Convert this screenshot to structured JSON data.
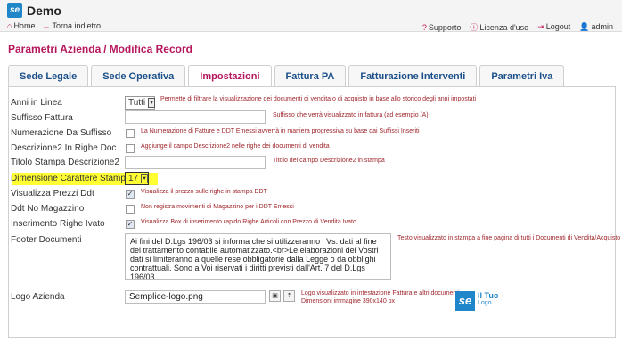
{
  "app": {
    "title": "Demo",
    "logo": "se"
  },
  "breadcrumb": {
    "home": "Home",
    "back": "Torna indietro"
  },
  "topnav": {
    "support": "Supporto",
    "license": "Licenza d'uso",
    "logout": "Logout",
    "user": "admin"
  },
  "page": {
    "title_part1": "Parametri Azienda",
    "title_sep": "/",
    "title_part2": "Modifica Record"
  },
  "tabs": [
    {
      "label": "Sede Legale"
    },
    {
      "label": "Sede Operativa"
    },
    {
      "label": "Impostazioni"
    },
    {
      "label": "Fattura PA"
    },
    {
      "label": "Fatturazione Interventi"
    },
    {
      "label": "Parametri Iva"
    }
  ],
  "active_tab": "Impostazioni",
  "fields": {
    "anni": {
      "label": "Anni in Linea",
      "value": "Tutti",
      "desc": "Permette di filtrare la visualizzazione dei documenti di vendita o di acquisto in base allo storico degli anni impostati"
    },
    "suffisso": {
      "label": "Suffisso Fattura",
      "value": "",
      "desc": "Suffisso che verrà visualizzato in fattura (ad esempio /A)"
    },
    "numerazione": {
      "label": "Numerazione Da Suffisso",
      "checked": false,
      "desc": "La Numerazione di Fatture e DDT Emessi avverrà in maniera progressiva su base dai Suffissi Inseriti"
    },
    "descrizione2": {
      "label": "Descrizione2 In Righe Doc",
      "checked": false,
      "desc": "Aggiunge il campo Descrizione2 nelle righe dei documenti di vendita"
    },
    "titolo": {
      "label": "Titolo Stampa Descrizione2",
      "value": "",
      "desc": "Titolo del campo Descrizione2 in stampa"
    },
    "dimensione": {
      "label": "Dimensione Carattere Stampa",
      "value": "17"
    },
    "prezzi": {
      "label": "Visualizza Prezzi Ddt",
      "checked": true,
      "desc": "Visualizza il prezzo sulle righe in stampa DDT"
    },
    "ddt": {
      "label": "Ddt No Magazzino",
      "checked": false,
      "desc": "Non registra movimenti di Magazzino per i DDT Emessi"
    },
    "inserimento": {
      "label": "Inserimento Righe Ivato",
      "checked": true,
      "desc": "Visualizza Box di inserimento rapido Righe Articoli con Prezzo di Vendita Ivato"
    },
    "footer": {
      "label": "Footer Documenti",
      "value": "Ai fini del D.Lgs 196/03 si informa che si utilizzeranno i Vs. dati al fine del trattamento contabile automatizzato.<br>Le elaborazioni dei Vostri dati si limiteranno a quelle rese obbligatorie dalla Legge o da obblighi contrattuali. Sono a Voi riservati i diritti previsti dall'Art. 7 del D.Lgs 196/03",
      "desc": "Testo visualizzato in stampa a fine pagina di tutti i Documenti di Vendita/Acquisto"
    },
    "logo": {
      "label": "Logo Azienda",
      "value": "Semplice-logo.png",
      "desc1": "Logo visualizzato in intestazione Fattura e altri documenti.",
      "desc2": "Dimensioni immagine 390x140 px"
    }
  },
  "logo_preview": {
    "mark": "se",
    "title": "Il Tuo",
    "subtitle": "Logo"
  },
  "colors": {
    "brand_pink": "#b5175c",
    "brand_blue": "#1e86c9",
    "highlight": "#ffff33",
    "desc_red": "#a0272d"
  }
}
